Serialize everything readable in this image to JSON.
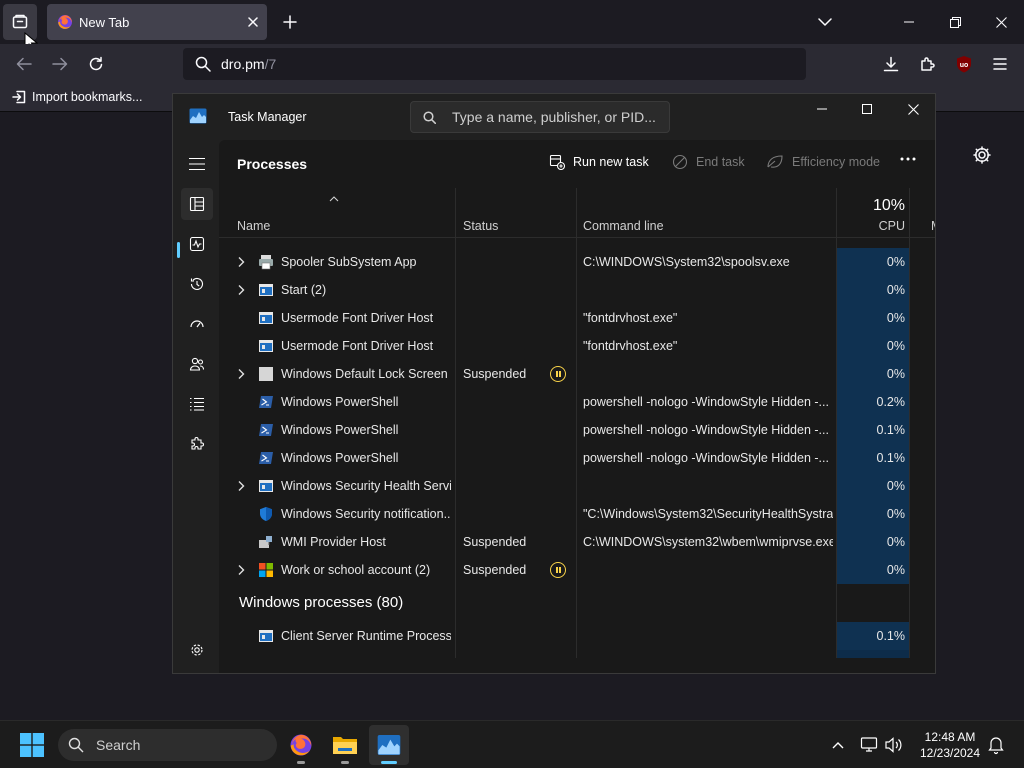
{
  "browser": {
    "tab_title": "New Tab",
    "url_main": "dro.pm",
    "url_path": "/7",
    "bookmark_import": "Import bookmarks..."
  },
  "task_manager": {
    "window_title": "Task Manager",
    "search_placeholder": "Type a name, publisher, or PID...",
    "page_title": "Processes",
    "commands": {
      "run_new_task": "Run new task",
      "end_task": "End task",
      "efficiency_mode": "Efficiency mode"
    },
    "columns": {
      "name": "Name",
      "status": "Status",
      "command_line": "Command line",
      "cpu_total": "10%",
      "cpu": "CPU",
      "memory_partial": "M"
    },
    "rows": [
      {
        "name": "Spooler SubSystem App",
        "status": "",
        "cmd": "C:\\WINDOWS\\System32\\spoolsv.exe",
        "cpu": "0%",
        "expandable": true,
        "icon": "printer-icon"
      },
      {
        "name": "Start (2)",
        "status": "",
        "cmd": "",
        "cpu": "0%",
        "expandable": true,
        "icon": "window-app-icon"
      },
      {
        "name": "Usermode Font Driver Host",
        "status": "",
        "cmd": "\"fontdrvhost.exe\"",
        "cpu": "0%",
        "expandable": false,
        "icon": "window-app-icon"
      },
      {
        "name": "Usermode Font Driver Host",
        "status": "",
        "cmd": "\"fontdrvhost.exe\"",
        "cpu": "0%",
        "expandable": false,
        "icon": "window-app-icon"
      },
      {
        "name": "Windows Default Lock Screen ...",
        "status": "Suspended",
        "cmd": "",
        "cpu": "0%",
        "expandable": true,
        "icon": "blank-app-icon",
        "paused": true
      },
      {
        "name": "Windows PowerShell",
        "status": "",
        "cmd": "powershell  -nologo -WindowStyle Hidden -...",
        "cpu": "0.2%",
        "expandable": false,
        "icon": "powershell-icon"
      },
      {
        "name": "Windows PowerShell",
        "status": "",
        "cmd": "powershell  -nologo -WindowStyle Hidden -...",
        "cpu": "0.1%",
        "expandable": false,
        "icon": "powershell-icon"
      },
      {
        "name": "Windows PowerShell",
        "status": "",
        "cmd": "powershell  -nologo -WindowStyle Hidden -...",
        "cpu": "0.1%",
        "expandable": false,
        "icon": "powershell-icon"
      },
      {
        "name": "Windows Security Health Servi...",
        "status": "",
        "cmd": "",
        "cpu": "0%",
        "expandable": true,
        "icon": "window-app-icon"
      },
      {
        "name": "Windows Security notification...",
        "status": "",
        "cmd": "\"C:\\Windows\\System32\\SecurityHealthSystra...",
        "cpu": "0%",
        "expandable": false,
        "icon": "shield-icon"
      },
      {
        "name": "WMI Provider Host",
        "status": "Suspended",
        "cmd": "C:\\WINDOWS\\system32\\wbem\\wmiprvse.exe",
        "cpu": "0%",
        "expandable": false,
        "icon": "wmi-icon"
      },
      {
        "name": "Work or school account (2)",
        "status": "Suspended",
        "cmd": "",
        "cpu": "0%",
        "expandable": true,
        "icon": "microsoft-logo-icon",
        "paused": true
      }
    ],
    "group_title": "Windows processes (80)",
    "group_rows": [
      {
        "name": "Client Server Runtime Process",
        "status": "",
        "cmd": "",
        "cpu": "0.1%",
        "expandable": false,
        "icon": "window-app-icon"
      }
    ]
  },
  "taskbar": {
    "search_label": "Search",
    "time": "12:48 AM",
    "date": "12/23/2024"
  },
  "colors": {
    "accent": "#60cdff",
    "cpu_cell": "#0f3151",
    "suspended_icon": "#f9d349"
  }
}
